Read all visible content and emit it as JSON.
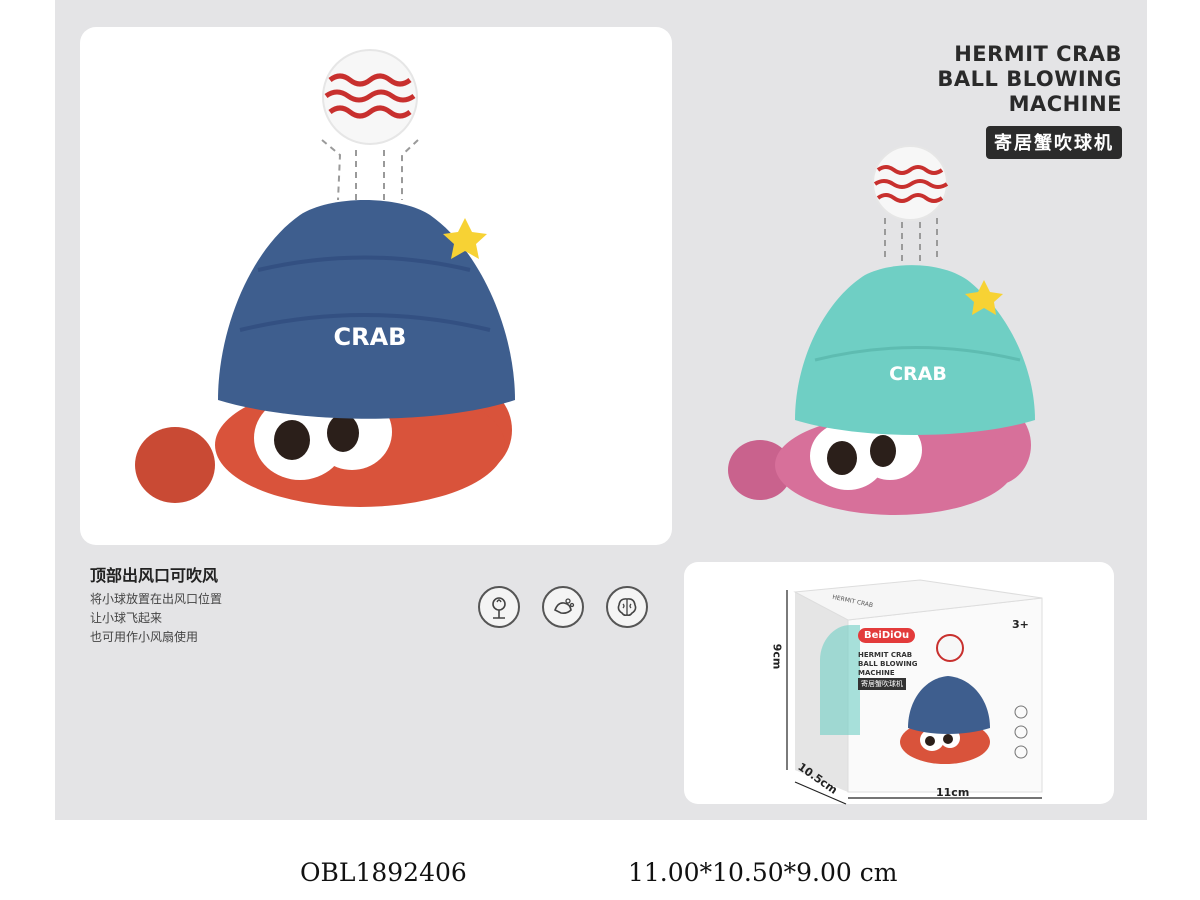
{
  "product": {
    "title_en_lines": [
      "HERMIT CRAB",
      "BALL BLOWING",
      "MACHINE"
    ],
    "title_cn": "寄居蟹吹球机"
  },
  "feature": {
    "heading": "顶部出风口可吹风",
    "lines": [
      "将小球放置在出风口位置",
      "让小球飞起来",
      "也可用作小风扇使用"
    ],
    "icons": [
      "sprout-head-icon",
      "hand-gesture-icon",
      "brain-icon"
    ]
  },
  "toys": [
    {
      "label": "CRAB",
      "shell_color": "#3e5e8e",
      "body_color": "#d9533b"
    },
    {
      "label": "CRAB",
      "shell_color": "#6fcfc4",
      "body_color": "#d7709a"
    }
  ],
  "package": {
    "brand": "BeiDiOu",
    "title_lines": [
      "HERMIT CRAB",
      "BALL BLOWING",
      "MACHINE"
    ],
    "title_cn": "寄居蟹吹球机",
    "side_text": "HERMIT CRAB",
    "age": "3+",
    "dim_height": "9cm",
    "dim_depth": "10.5cm",
    "dim_width": "11cm"
  },
  "footer": {
    "sku": "OBL1892406",
    "dimensions": "11.00*10.50*9.00 cm"
  },
  "colors": {
    "poster_bg": "#e4e4e6",
    "ball_stripe": "#c8302e",
    "star": "#f7d234"
  }
}
